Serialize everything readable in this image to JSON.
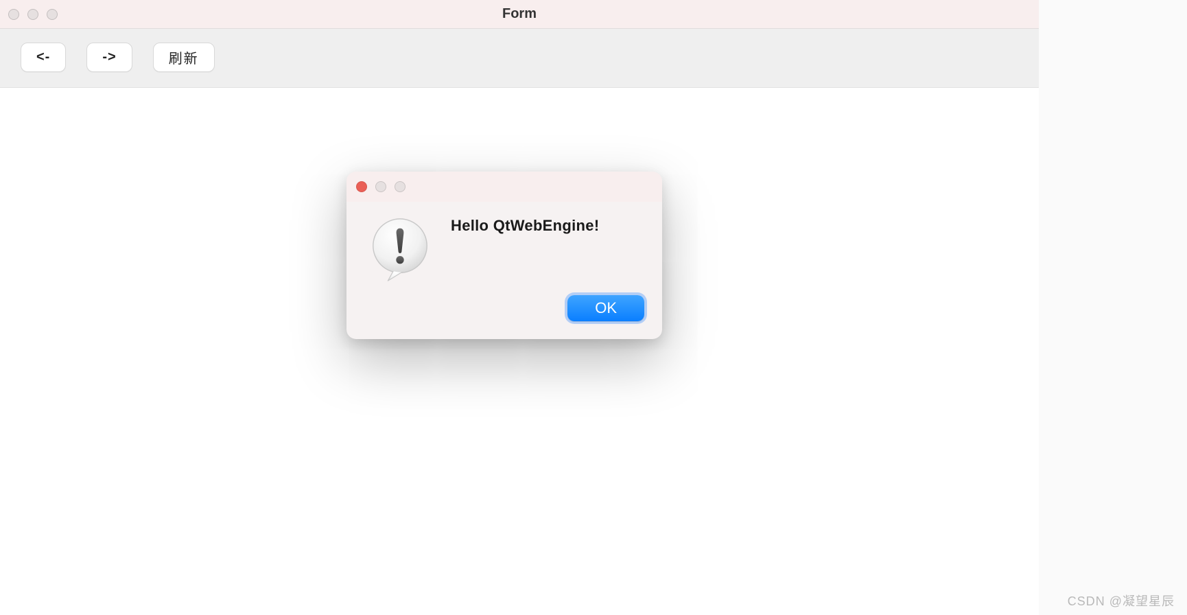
{
  "main": {
    "title": "Form"
  },
  "toolbar": {
    "back_label": "<-",
    "forward_label": "->",
    "refresh_label": "刷新"
  },
  "dialog": {
    "heading": "Hello QtWebEngine!",
    "ok_label": "OK"
  },
  "watermark": "CSDN @凝望星辰"
}
